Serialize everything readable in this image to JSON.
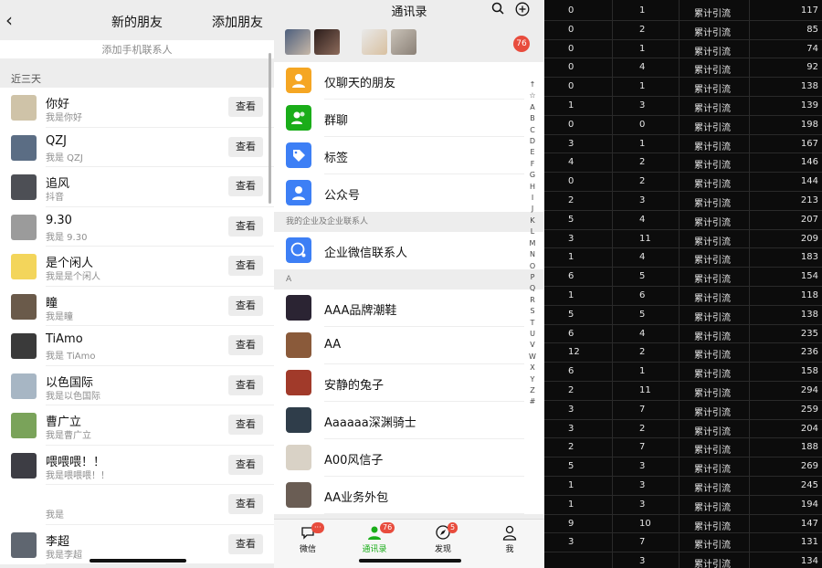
{
  "new_friends": {
    "title": "新的朋友",
    "add_label": "添加朋友",
    "add_phone_label": "添加手机联系人",
    "section_recent": "近三天",
    "view_label": "查看",
    "items": [
      {
        "name": "你好",
        "sub": "我是你好"
      },
      {
        "name": "QZJ",
        "sub": "我是 QZJ"
      },
      {
        "name": "追风",
        "sub": "抖音"
      },
      {
        "name": "9.30",
        "sub": "我是 9.30"
      },
      {
        "name": "是个闲人",
        "sub": "我是是个闲人"
      },
      {
        "name": "瞳",
        "sub": "我是瞳"
      },
      {
        "name": "TiAmo",
        "sub": "我是 TiAmo"
      },
      {
        "name": "以色国际",
        "sub": "我是以色国际"
      },
      {
        "name": "曹广立",
        "sub": "我是曹广立"
      },
      {
        "name": "喂喂喂！！",
        "sub": "我是喂喂喂！！"
      },
      {
        "name": "",
        "sub": "我是"
      },
      {
        "name": "李超",
        "sub": "我是李超"
      }
    ]
  },
  "contacts": {
    "title": "通讯录",
    "badge_count": "76",
    "special_items": [
      {
        "label": "仅聊天的朋友",
        "icon": "person-icon",
        "color": "#f5a623"
      },
      {
        "label": "群聊",
        "icon": "group-icon",
        "color": "#1aad19"
      },
      {
        "label": "标签",
        "icon": "tag-icon",
        "color": "#3d7ff5"
      },
      {
        "label": "公众号",
        "icon": "official-account-icon",
        "color": "#3d7ff5"
      }
    ],
    "enterprise_header": "我的企业及企业联系人",
    "enterprise_item": "企业微信联系人",
    "letter_header": "A",
    "contacts": [
      "AAA品牌潮鞋",
      "AA",
      "安静的兔子",
      "Aaaaaa深渊骑士",
      "A00风信子",
      "AA业务外包"
    ],
    "index": [
      "↑",
      "☆",
      "A",
      "B",
      "C",
      "D",
      "E",
      "F",
      "G",
      "H",
      "I",
      "J",
      "K",
      "L",
      "M",
      "N",
      "O",
      "P",
      "Q",
      "R",
      "S",
      "T",
      "U",
      "V",
      "W",
      "X",
      "Y",
      "Z",
      "#"
    ],
    "tabs": [
      {
        "label": "微信",
        "badge": "···"
      },
      {
        "label": "通讯录",
        "badge": "76"
      },
      {
        "label": "发现",
        "badge": "5"
      },
      {
        "label": "我",
        "badge": ""
      }
    ]
  },
  "table": {
    "label": "累计引流",
    "rows": [
      [
        "0",
        "1",
        "117"
      ],
      [
        "0",
        "2",
        "85"
      ],
      [
        "0",
        "1",
        "74"
      ],
      [
        "0",
        "4",
        "92"
      ],
      [
        "0",
        "1",
        "138"
      ],
      [
        "1",
        "3",
        "139"
      ],
      [
        "0",
        "0",
        "198"
      ],
      [
        "3",
        "1",
        "167"
      ],
      [
        "4",
        "2",
        "146"
      ],
      [
        "0",
        "2",
        "144"
      ],
      [
        "2",
        "3",
        "213"
      ],
      [
        "5",
        "4",
        "207"
      ],
      [
        "3",
        "11",
        "209"
      ],
      [
        "1",
        "4",
        "183"
      ],
      [
        "6",
        "5",
        "154"
      ],
      [
        "1",
        "6",
        "118"
      ],
      [
        "5",
        "5",
        "138"
      ],
      [
        "6",
        "4",
        "235"
      ],
      [
        "12",
        "2",
        "236"
      ],
      [
        "6",
        "1",
        "158"
      ],
      [
        "2",
        "11",
        "294"
      ],
      [
        "3",
        "7",
        "259"
      ],
      [
        "3",
        "2",
        "204"
      ],
      [
        "2",
        "7",
        "188"
      ],
      [
        "5",
        "3",
        "269"
      ],
      [
        "1",
        "3",
        "245"
      ],
      [
        "1",
        "3",
        "194"
      ],
      [
        "9",
        "10",
        "147"
      ],
      [
        "3",
        "7",
        "131"
      ],
      [
        "",
        "3",
        "134"
      ]
    ]
  }
}
